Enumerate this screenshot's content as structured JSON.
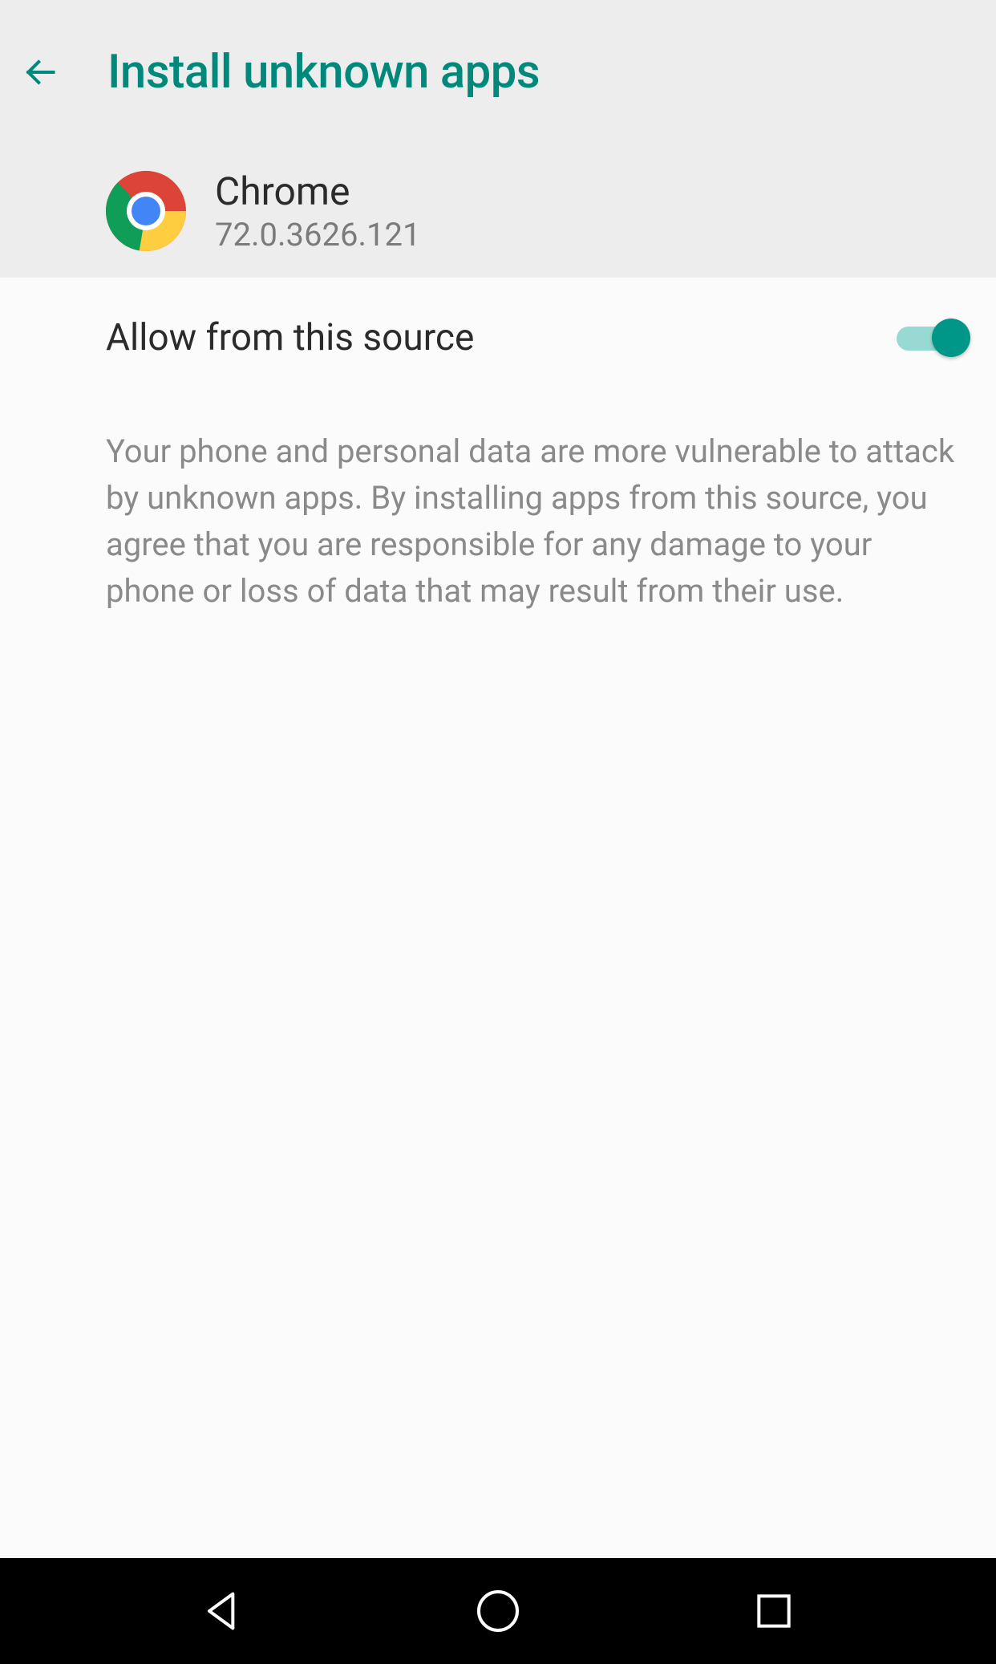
{
  "header": {
    "title": "Install unknown apps"
  },
  "app": {
    "name": "Chrome",
    "version": "72.0.3626.121"
  },
  "setting": {
    "allow_label": "Allow from this source",
    "enabled": true,
    "warning": "Your phone and personal data are more vulnerable to attack by unknown apps. By installing apps from this source, you agree that you are responsible for any damage to your phone or loss of data that may result from their use."
  },
  "colors": {
    "accent": "#00897b",
    "accent_light": "#99d9d3",
    "header_bg": "#ededed",
    "body_bg": "#fbfbfb"
  }
}
